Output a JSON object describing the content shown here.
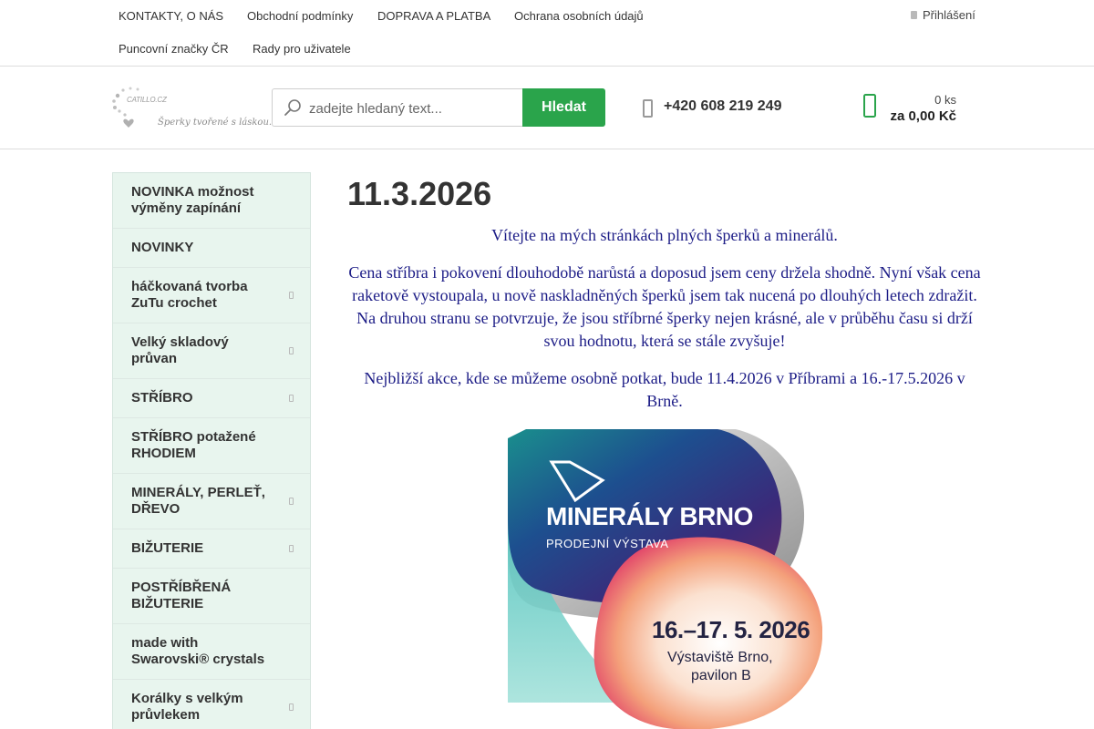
{
  "topnav": {
    "links": [
      "KONTAKTY, O NÁS",
      "Obchodní podmínky",
      "DOPRAVA A PLATBA",
      "Ochrana osobních údajů",
      "Puncovní značky ČR",
      "Rady pro uživatele"
    ],
    "login_label": "Přihlášení"
  },
  "header": {
    "logo_text": "CATILLO.CZ",
    "logo_tagline": "Šperky tvořené s láskou...",
    "search_placeholder": "zadejte hledaný text...",
    "search_button": "Hledat",
    "phone": "+420 608 219 249",
    "cart_count": "0 ks",
    "cart_total": "za 0,00 Kč",
    "accent_color": "#2aa44b"
  },
  "sidebar": {
    "items": [
      {
        "label": "NOVINKA možnost výměny zapínání",
        "has_submenu": false
      },
      {
        "label": "NOVINKY",
        "has_submenu": false
      },
      {
        "label": "háčkovaná tvorba ZuTu crochet",
        "has_submenu": true
      },
      {
        "label": "Velký skladový průvan",
        "has_submenu": true
      },
      {
        "label": "STŘÍBRO",
        "has_submenu": true
      },
      {
        "label": "STŘÍBRO potažené RHODIEM",
        "has_submenu": false
      },
      {
        "label": "MINERÁLY, PERLEŤ, DŘEVO",
        "has_submenu": true
      },
      {
        "label": "BIŽUTERIE",
        "has_submenu": true
      },
      {
        "label": "POSTŘÍBŘENÁ BIŽUTERIE",
        "has_submenu": false
      },
      {
        "label": "made with Swarovski® crystals",
        "has_submenu": false
      },
      {
        "label": "Korálky s velkým průvlekem",
        "has_submenu": true
      }
    ]
  },
  "main": {
    "title": "11.3.2026",
    "paragraphs": [
      "Vítejte na mých stránkách plných šperků a minerálů.",
      "Cena stříbra i pokovení dlouhodobě narůstá a doposud jsem ceny držela shodně. Nyní však cena raketově vystoupala, u nově naskladněných šperků jsem tak nucená po dlouhých letech zdražit. Na druhou stranu se potvrzuje, že jsou stříbrné šperky nejen krásné, ale v průběhu času si drží svou hodnotu, která se stále zvyšuje!",
      "Nejbližší akce, kde se můžeme osobně potkat, bude 11.4.2026 v Příbrami a 16.-17.5.2026 v Brně."
    ],
    "banner": {
      "title": "MINERÁLY BRNO",
      "subtitle": "PRODEJNÍ VÝSTAVA",
      "dates": "16.–17. 5. 2026",
      "place_line1": "Výstaviště Brno,",
      "place_line2": "pavilon B"
    }
  }
}
